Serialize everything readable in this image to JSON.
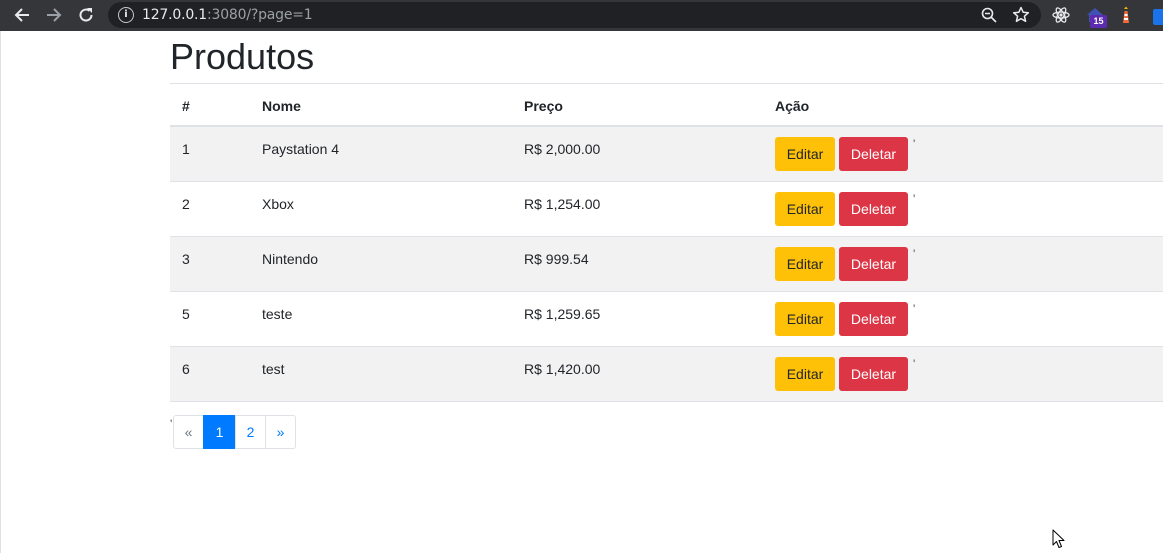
{
  "browser": {
    "url_host": "127.0.0.1",
    "url_rest": ":3080/?page=1",
    "extension_badge": "15"
  },
  "page": {
    "title": "Produtos"
  },
  "table": {
    "headers": [
      "#",
      "Nome",
      "Preço",
      "Ação"
    ],
    "rows": [
      {
        "id": "1",
        "nome": "Paystation 4",
        "preco": "R$ 2,000.00",
        "editar": "Editar",
        "deletar": "Deletar",
        "tick": "'"
      },
      {
        "id": "2",
        "nome": "Xbox",
        "preco": "R$ 1,254.00",
        "editar": "Editar",
        "deletar": "Deletar",
        "tick": "'"
      },
      {
        "id": "3",
        "nome": "Nintendo",
        "preco": "R$ 999.54",
        "editar": "Editar",
        "deletar": "Deletar",
        "tick": "'"
      },
      {
        "id": "5",
        "nome": "teste",
        "preco": "R$ 1,259.65",
        "editar": "Editar",
        "deletar": "Deletar",
        "tick": "'"
      },
      {
        "id": "6",
        "nome": "test",
        "preco": "R$ 1,420.00",
        "editar": "Editar",
        "deletar": "Deletar",
        "tick": "'"
      }
    ]
  },
  "pagination": {
    "tick": "'",
    "items": [
      {
        "label": "«",
        "active": false
      },
      {
        "label": "1",
        "active": true
      },
      {
        "label": "2",
        "active": false
      },
      {
        "label": "»",
        "active": false
      }
    ]
  },
  "colors": {
    "edit": "#ffc107",
    "delete": "#dc3545",
    "active_page": "#007bff",
    "stripe": "#f2f2f2"
  }
}
